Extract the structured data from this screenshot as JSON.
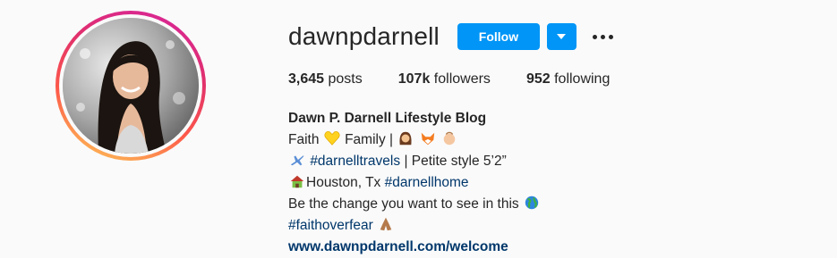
{
  "profile": {
    "username": "dawnpdarnell",
    "follow_label": "Follow",
    "dropdown_icon": "chevron-down-icon",
    "more_icon": "more-options-icon"
  },
  "stats": {
    "posts_count": "3,645",
    "posts_label": "posts",
    "followers_count": "107k",
    "followers_label": "followers",
    "following_count": "952",
    "following_label": "following"
  },
  "bio": {
    "name": "Dawn P. Darnell Lifestyle Blog",
    "line1_a": "Faith",
    "line1_b": "Family |",
    "line2_hashtag": "#darnelltravels",
    "line2_text": "| Petite style 5’2”",
    "line3_text": "Houston, Tx",
    "line3_hashtag": "#darnellhome",
    "line4_text": "Be the change you want to see in this",
    "line5_hashtag": "#faithoverfear",
    "website": "www.dawnpdarnell.com/welcome"
  },
  "colors": {
    "accent": "#0095f6",
    "link": "#00376b",
    "text": "#262626",
    "background": "#fafafa"
  }
}
